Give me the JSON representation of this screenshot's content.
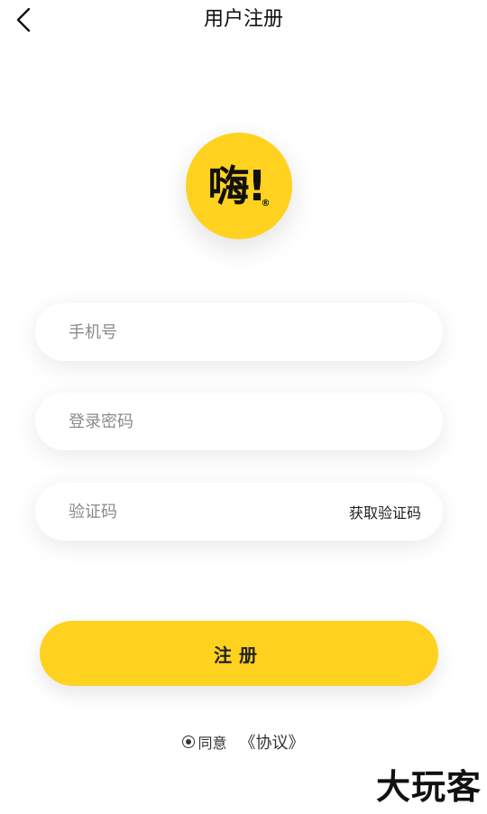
{
  "header": {
    "title": "用户注册",
    "back_icon": "chevron-left-icon"
  },
  "logo": {
    "text": "嗨!",
    "mark": "®",
    "color": "#fed21f"
  },
  "form": {
    "phone_placeholder": "手机号",
    "password_placeholder": "登录密码",
    "code_placeholder": "验证码",
    "get_code_label": "获取验证码"
  },
  "register_label": "注册",
  "agreement": {
    "agree_label": "同意",
    "protocol_link": "《协议》",
    "checked": true
  },
  "watermark": "大玩客",
  "colors": {
    "accent": "#fed21f",
    "text": "#222222",
    "placeholder": "#8a8a8a"
  }
}
